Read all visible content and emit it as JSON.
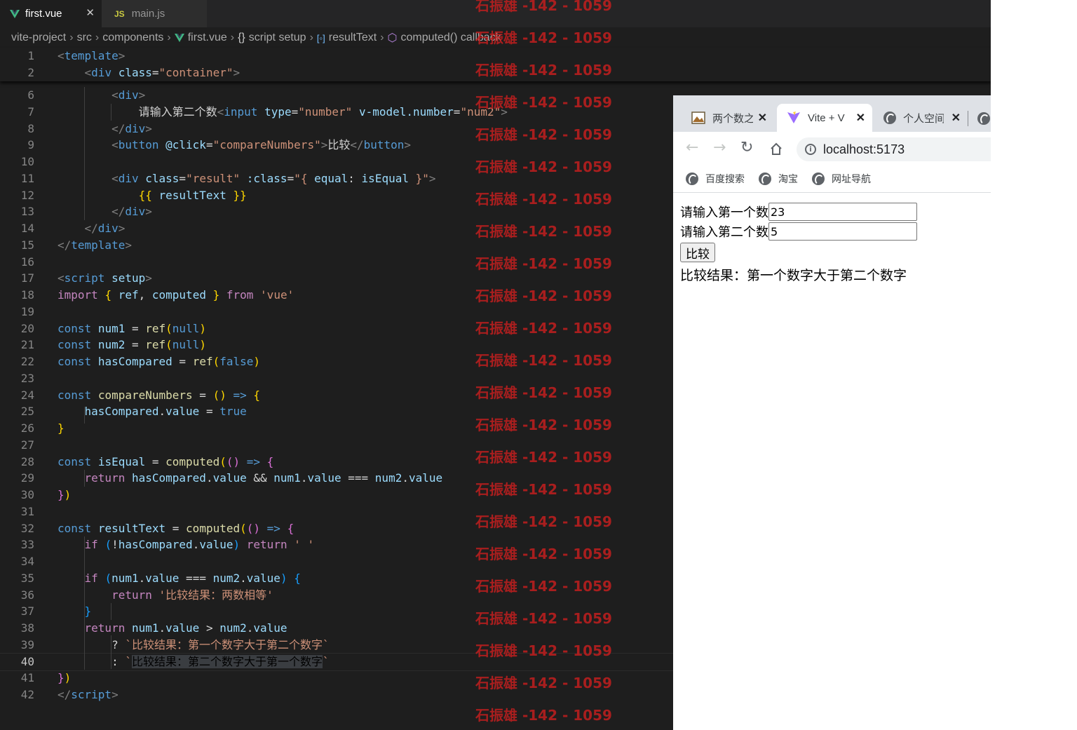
{
  "editor": {
    "tabs": [
      {
        "label": "first.vue",
        "icon": "vue-icon",
        "active": true,
        "close": "✕"
      },
      {
        "label": "main.js",
        "icon": "js-icon",
        "active": false
      }
    ],
    "breadcrumb": [
      "vite-project",
      "src",
      "components",
      "first.vue",
      "script setup",
      "resultText",
      "computed() callback"
    ],
    "breadcrumb_icons": {
      "first.vue": "vue-icon",
      "script setup": "braces-icon",
      "resultText": "variable-icon",
      "computed() callback": "cube-icon"
    },
    "sticky_lines": [
      {
        "n": "1",
        "tokens": [
          [
            "tb",
            "<"
          ],
          [
            "tag",
            "template"
          ],
          [
            "tb",
            ">"
          ]
        ]
      },
      {
        "n": "2",
        "tokens": [
          [
            "pl",
            "    "
          ],
          [
            "tb",
            "<"
          ],
          [
            "tag",
            "div"
          ],
          [
            "pl",
            " "
          ],
          [
            "attr",
            "class"
          ],
          [
            "pl",
            "="
          ],
          [
            "str",
            "\"container\""
          ],
          [
            "tb",
            ">"
          ]
        ]
      }
    ],
    "lines": [
      {
        "n": "6",
        "tokens": [
          [
            "pl",
            "        "
          ],
          [
            "tb",
            "<"
          ],
          [
            "tag",
            "div"
          ],
          [
            "tb",
            ">"
          ]
        ]
      },
      {
        "n": "7",
        "tokens": [
          [
            "pl",
            "            请输入第二个数"
          ],
          [
            "tb",
            "<"
          ],
          [
            "tag",
            "input"
          ],
          [
            "pl",
            " "
          ],
          [
            "attr",
            "type"
          ],
          [
            "pl",
            "="
          ],
          [
            "str",
            "\"number\""
          ],
          [
            "pl",
            " "
          ],
          [
            "attr",
            "v-model.number"
          ],
          [
            "pl",
            "="
          ],
          [
            "str",
            "\"num2\""
          ],
          [
            "tb",
            ">"
          ]
        ]
      },
      {
        "n": "8",
        "tokens": [
          [
            "pl",
            "        "
          ],
          [
            "tb",
            "</"
          ],
          [
            "tag",
            "div"
          ],
          [
            "tb",
            ">"
          ]
        ]
      },
      {
        "n": "9",
        "tokens": [
          [
            "pl",
            "        "
          ],
          [
            "tb",
            "<"
          ],
          [
            "tag",
            "button"
          ],
          [
            "pl",
            " "
          ],
          [
            "attr",
            "@click"
          ],
          [
            "pl",
            "="
          ],
          [
            "str",
            "\"compareNumbers\""
          ],
          [
            "tb",
            ">"
          ],
          [
            "pl",
            "比较"
          ],
          [
            "tb",
            "</"
          ],
          [
            "tag",
            "button"
          ],
          [
            "tb",
            ">"
          ]
        ]
      },
      {
        "n": "10",
        "tokens": []
      },
      {
        "n": "11",
        "tokens": [
          [
            "pl",
            "        "
          ],
          [
            "tb",
            "<"
          ],
          [
            "tag",
            "div"
          ],
          [
            "pl",
            " "
          ],
          [
            "attr",
            "class"
          ],
          [
            "pl",
            "="
          ],
          [
            "str",
            "\"result\""
          ],
          [
            "pl",
            " "
          ],
          [
            "attr",
            ":class"
          ],
          [
            "pl",
            "="
          ],
          [
            "str",
            "\"{ "
          ],
          [
            "var",
            "equal"
          ],
          [
            "pl",
            ": "
          ],
          [
            "var",
            "isEqual"
          ],
          [
            "str",
            " }\""
          ],
          [
            "tb",
            ">"
          ]
        ]
      },
      {
        "n": "12",
        "tokens": [
          [
            "pl",
            "            "
          ],
          [
            "b1",
            "{{"
          ],
          [
            "pl",
            " "
          ],
          [
            "var",
            "resultText"
          ],
          [
            "pl",
            " "
          ],
          [
            "b1",
            "}}"
          ]
        ]
      },
      {
        "n": "13",
        "tokens": [
          [
            "pl",
            "        "
          ],
          [
            "tb",
            "</"
          ],
          [
            "tag",
            "div"
          ],
          [
            "tb",
            ">"
          ]
        ]
      },
      {
        "n": "14",
        "tokens": [
          [
            "pl",
            "    "
          ],
          [
            "tb",
            "</"
          ],
          [
            "tag",
            "div"
          ],
          [
            "tb",
            ">"
          ]
        ]
      },
      {
        "n": "15",
        "tokens": [
          [
            "tb",
            "</"
          ],
          [
            "tag",
            "template"
          ],
          [
            "tb",
            ">"
          ]
        ]
      },
      {
        "n": "16",
        "tokens": []
      },
      {
        "n": "17",
        "tokens": [
          [
            "tb",
            "<"
          ],
          [
            "tag",
            "script"
          ],
          [
            "pl",
            " "
          ],
          [
            "attr",
            "setup"
          ],
          [
            "tb",
            ">"
          ]
        ]
      },
      {
        "n": "18",
        "tokens": [
          [
            "ctl",
            "import"
          ],
          [
            "pl",
            " "
          ],
          [
            "b1",
            "{"
          ],
          [
            "pl",
            " "
          ],
          [
            "var",
            "ref"
          ],
          [
            "pl",
            ", "
          ],
          [
            "var",
            "computed"
          ],
          [
            "pl",
            " "
          ],
          [
            "b1",
            "}"
          ],
          [
            "pl",
            " "
          ],
          [
            "ctl",
            "from"
          ],
          [
            "pl",
            " "
          ],
          [
            "str",
            "'vue'"
          ]
        ]
      },
      {
        "n": "19",
        "tokens": []
      },
      {
        "n": "20",
        "tokens": [
          [
            "kw",
            "const"
          ],
          [
            "pl",
            " "
          ],
          [
            "var",
            "num1"
          ],
          [
            "pl",
            " = "
          ],
          [
            "fn",
            "ref"
          ],
          [
            "b1",
            "("
          ],
          [
            "kw",
            "null"
          ],
          [
            "b1",
            ")"
          ]
        ]
      },
      {
        "n": "21",
        "tokens": [
          [
            "kw",
            "const"
          ],
          [
            "pl",
            " "
          ],
          [
            "var",
            "num2"
          ],
          [
            "pl",
            " = "
          ],
          [
            "fn",
            "ref"
          ],
          [
            "b1",
            "("
          ],
          [
            "kw",
            "null"
          ],
          [
            "b1",
            ")"
          ]
        ]
      },
      {
        "n": "22",
        "tokens": [
          [
            "kw",
            "const"
          ],
          [
            "pl",
            " "
          ],
          [
            "var",
            "hasCompared"
          ],
          [
            "pl",
            " = "
          ],
          [
            "fn",
            "ref"
          ],
          [
            "b1",
            "("
          ],
          [
            "kw",
            "false"
          ],
          [
            "b1",
            ")"
          ]
        ]
      },
      {
        "n": "23",
        "tokens": []
      },
      {
        "n": "24",
        "tokens": [
          [
            "kw",
            "const"
          ],
          [
            "pl",
            " "
          ],
          [
            "fn",
            "compareNumbers"
          ],
          [
            "pl",
            " = "
          ],
          [
            "b1",
            "()"
          ],
          [
            "pl",
            " "
          ],
          [
            "kw",
            "=>"
          ],
          [
            "pl",
            " "
          ],
          [
            "b1",
            "{"
          ]
        ]
      },
      {
        "n": "25",
        "tokens": [
          [
            "pl",
            "    "
          ],
          [
            "var",
            "hasCompared"
          ],
          [
            "pl",
            "."
          ],
          [
            "var",
            "value"
          ],
          [
            "pl",
            " = "
          ],
          [
            "kw",
            "true"
          ]
        ]
      },
      {
        "n": "26",
        "tokens": [
          [
            "b1",
            "}"
          ]
        ]
      },
      {
        "n": "27",
        "tokens": []
      },
      {
        "n": "28",
        "tokens": [
          [
            "kw",
            "const"
          ],
          [
            "pl",
            " "
          ],
          [
            "var",
            "isEqual"
          ],
          [
            "pl",
            " = "
          ],
          [
            "fn",
            "computed"
          ],
          [
            "b1",
            "("
          ],
          [
            "b2",
            "()"
          ],
          [
            "pl",
            " "
          ],
          [
            "kw",
            "=>"
          ],
          [
            "pl",
            " "
          ],
          [
            "b2",
            "{"
          ]
        ]
      },
      {
        "n": "29",
        "tokens": [
          [
            "pl",
            "    "
          ],
          [
            "ctl",
            "return"
          ],
          [
            "pl",
            " "
          ],
          [
            "var",
            "hasCompared"
          ],
          [
            "pl",
            "."
          ],
          [
            "var",
            "value"
          ],
          [
            "pl",
            " && "
          ],
          [
            "var",
            "num1"
          ],
          [
            "pl",
            "."
          ],
          [
            "var",
            "value"
          ],
          [
            "pl",
            " === "
          ],
          [
            "var",
            "num2"
          ],
          [
            "pl",
            "."
          ],
          [
            "var",
            "value"
          ]
        ]
      },
      {
        "n": "30",
        "tokens": [
          [
            "b2",
            "}"
          ],
          [
            "b1",
            ")"
          ]
        ]
      },
      {
        "n": "31",
        "tokens": []
      },
      {
        "n": "32",
        "tokens": [
          [
            "kw",
            "const"
          ],
          [
            "pl",
            " "
          ],
          [
            "var",
            "resultText"
          ],
          [
            "pl",
            " = "
          ],
          [
            "fn",
            "computed"
          ],
          [
            "b1",
            "("
          ],
          [
            "b2",
            "()"
          ],
          [
            "pl",
            " "
          ],
          [
            "kw",
            "=>"
          ],
          [
            "pl",
            " "
          ],
          [
            "b2",
            "{"
          ]
        ]
      },
      {
        "n": "33",
        "tokens": [
          [
            "pl",
            "    "
          ],
          [
            "ctl",
            "if"
          ],
          [
            "pl",
            " "
          ],
          [
            "b3",
            "("
          ],
          [
            "pl",
            "!"
          ],
          [
            "var",
            "hasCompared"
          ],
          [
            "pl",
            "."
          ],
          [
            "var",
            "value"
          ],
          [
            "b3",
            ")"
          ],
          [
            "pl",
            " "
          ],
          [
            "ctl",
            "return"
          ],
          [
            "pl",
            " "
          ],
          [
            "str",
            "' '"
          ]
        ]
      },
      {
        "n": "34",
        "tokens": []
      },
      {
        "n": "35",
        "tokens": [
          [
            "pl",
            "    "
          ],
          [
            "ctl",
            "if"
          ],
          [
            "pl",
            " "
          ],
          [
            "b3",
            "("
          ],
          [
            "var",
            "num1"
          ],
          [
            "pl",
            "."
          ],
          [
            "var",
            "value"
          ],
          [
            "pl",
            " === "
          ],
          [
            "var",
            "num2"
          ],
          [
            "pl",
            "."
          ],
          [
            "var",
            "value"
          ],
          [
            "b3",
            ")"
          ],
          [
            "pl",
            " "
          ],
          [
            "b3",
            "{"
          ]
        ]
      },
      {
        "n": "36",
        "tokens": [
          [
            "pl",
            "        "
          ],
          [
            "ctl",
            "return"
          ],
          [
            "pl",
            " "
          ],
          [
            "str",
            "'比较结果：两数相等'"
          ]
        ]
      },
      {
        "n": "37",
        "tokens": [
          [
            "pl",
            "    "
          ],
          [
            "b3",
            "}"
          ]
        ]
      },
      {
        "n": "38",
        "tokens": [
          [
            "pl",
            "    "
          ],
          [
            "ctl",
            "return"
          ],
          [
            "pl",
            " "
          ],
          [
            "var",
            "num1"
          ],
          [
            "pl",
            "."
          ],
          [
            "var",
            "value"
          ],
          [
            "pl",
            " > "
          ],
          [
            "var",
            "num2"
          ],
          [
            "pl",
            "."
          ],
          [
            "var",
            "value"
          ]
        ]
      },
      {
        "n": "39",
        "tokens": [
          [
            "pl",
            "        ? "
          ],
          [
            "str",
            "`比较结果：第一个数字大于第二个数字`"
          ]
        ]
      },
      {
        "n": "40",
        "tokens": [
          [
            "pl",
            "        : "
          ],
          [
            "str",
            "`"
          ],
          [
            "hl",
            "比较结果：第二个数字大于第一个数字"
          ],
          [
            "str",
            "`"
          ]
        ]
      },
      {
        "n": "41",
        "tokens": [
          [
            "b2",
            "}"
          ],
          [
            "b1",
            ")"
          ]
        ]
      },
      {
        "n": "42",
        "tokens": [
          [
            "tb",
            "</"
          ],
          [
            "tag",
            "script"
          ],
          [
            "tb",
            ">"
          ]
        ]
      }
    ],
    "current_line": "40",
    "watermark": "石振雄 -142 - 1059"
  },
  "browser": {
    "tabs": [
      {
        "label": "两个数之",
        "icon": "image-favicon-icon",
        "active": false
      },
      {
        "label": "Vite + V",
        "icon": "vite-icon",
        "active": true
      },
      {
        "label": "个人空间",
        "icon": "globe-icon",
        "active": false
      }
    ],
    "tab_close": "✕",
    "url": "localhost:5173",
    "bookmarks": [
      "百度搜索",
      "淘宝",
      "网址导航"
    ],
    "page": {
      "label1": "请输入第一个数",
      "value1": "23",
      "label2": "请输入第二个数",
      "value2": "5",
      "button": "比较",
      "result": "比较结果：第一个数字大于第二个数字"
    }
  }
}
